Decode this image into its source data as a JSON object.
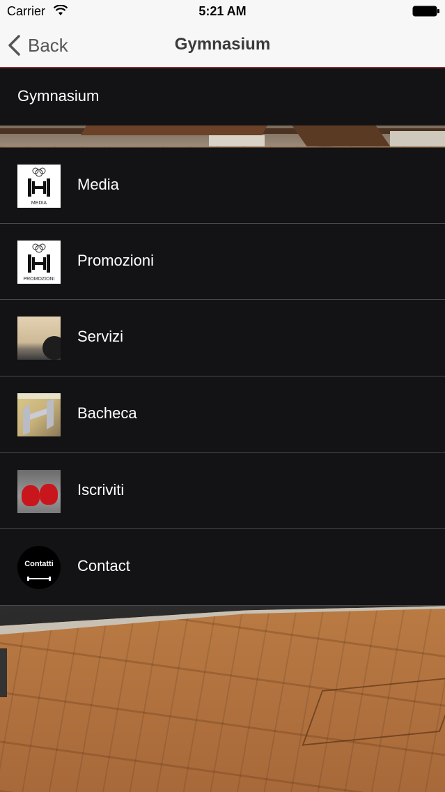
{
  "status_bar": {
    "carrier": "Carrier",
    "time": "5:21 AM",
    "wifi_icon": "wifi-icon",
    "battery_icon": "battery-icon"
  },
  "nav": {
    "back_label": "Back",
    "back_icon": "chevron-left-icon",
    "title": "Gymnasium"
  },
  "section": {
    "title": "Gymnasium"
  },
  "menu": {
    "items": [
      {
        "label": "Media",
        "thumb_caption": "MEDIA",
        "thumb": "dumbbell-logo-media"
      },
      {
        "label": "Promozioni",
        "thumb_caption": "PROMOZIONI",
        "thumb": "dumbbell-logo-promozioni"
      },
      {
        "label": "Servizi",
        "thumb": "gym-photo-ball"
      },
      {
        "label": "Bacheca",
        "thumb": "gym-photo-sign"
      },
      {
        "label": "Iscriviti",
        "thumb": "boxing-gloves-photo"
      },
      {
        "label": "Contact",
        "thumb_caption": "Contatti",
        "thumb": "contatti-logo"
      }
    ]
  },
  "colors": {
    "list_background": "#131214",
    "nav_background": "#f7f7f7",
    "nav_border": "#8b2f2f",
    "separator": "#4a4a4a",
    "text_on_dark": "#ffffff"
  }
}
